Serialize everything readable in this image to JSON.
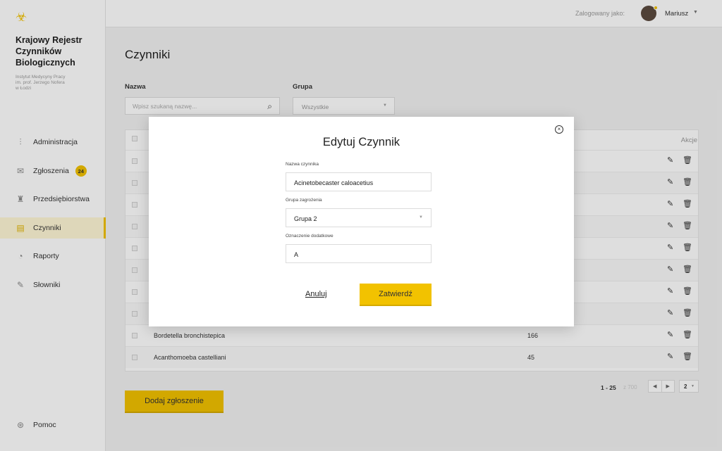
{
  "sidebar": {
    "logo_icon": "biohazard-icon",
    "brand_title": "Krajowy Rejestr\nCzynników\nBiologicznych",
    "brand_subtitle": "Instytut Medycyny Pracy\nim. prof. Jerzego Nofera\nw Łodzi",
    "items": [
      {
        "label": "Administracja",
        "icon": "sliders-icon"
      },
      {
        "label": "Zgłoszenia",
        "icon": "inbox-icon",
        "badge": "24"
      },
      {
        "label": "Przedsiębiorstwa",
        "icon": "factory-icon"
      },
      {
        "label": "Czynniki",
        "icon": "document-icon",
        "active": true
      },
      {
        "label": "Raporty",
        "icon": "pie-chart-icon"
      },
      {
        "label": "Słowniki",
        "icon": "edit-icon"
      }
    ],
    "help_label": "Pomoc"
  },
  "topbar": {
    "logged_label": "Zalogowany jako:",
    "user_name": "Mariusz"
  },
  "main": {
    "title": "Czynniki",
    "filter_name_label": "Nazwa",
    "search_placeholder": "Wpisz szukaną nazwę...",
    "filter_group_label": "Grupa",
    "group_value": "Wszystkie",
    "actions_header": "Akcje",
    "rows": [
      {
        "name": "",
        "count": ""
      },
      {
        "name": "",
        "count": ""
      },
      {
        "name": "",
        "count": ""
      },
      {
        "name": "",
        "count": ""
      },
      {
        "name": "",
        "count": ""
      },
      {
        "name": "",
        "count": ""
      },
      {
        "name": "",
        "count": ""
      },
      {
        "name": "",
        "count": ""
      },
      {
        "name": "Bordetella bronchistepica",
        "count": "166"
      },
      {
        "name": "Acanthomoeba castelliani",
        "count": "45"
      }
    ],
    "pager_range": "1 - 25",
    "pager_total": "z 700",
    "pager_page": "2",
    "add_button": "Dodaj zgłoszenie"
  },
  "modal": {
    "title": "Edytuj Czynnik",
    "name_label": "Nazwa czynnika",
    "name_value": "Acinetobecaster caloacetius",
    "group_label": "Grupa zagrożenia",
    "group_value": "Grupa 2",
    "extra_label": "Oznaczenie dodatkowe",
    "extra_value": "A",
    "cancel": "Anuluj",
    "confirm": "Zatwierdź"
  },
  "colors": {
    "accent": "#f2c200"
  }
}
